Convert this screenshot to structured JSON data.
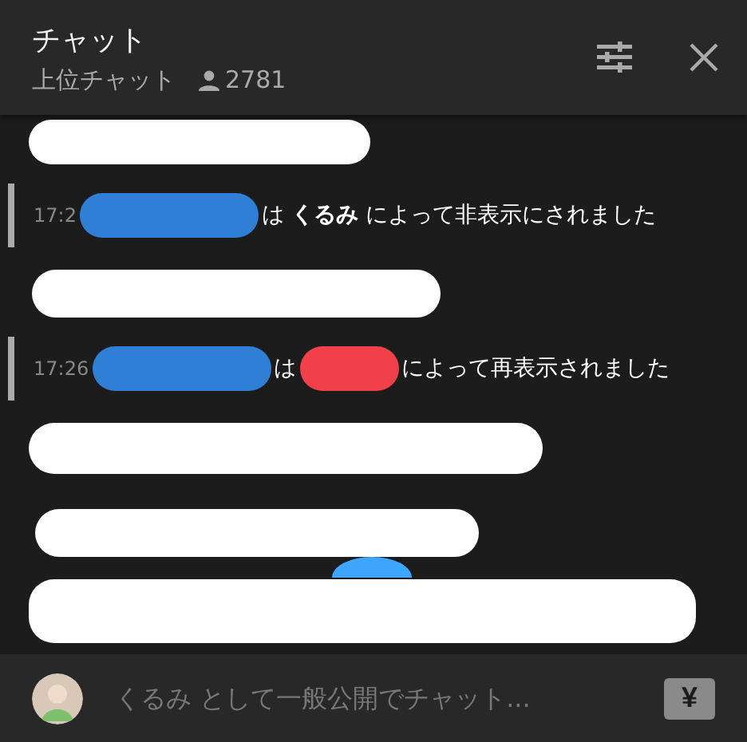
{
  "header": {
    "title": "チャット",
    "subtitle": "上位チャット",
    "viewer_count": "2781"
  },
  "messages": [
    {
      "kind": "redacted",
      "color": "#ffffff"
    },
    {
      "kind": "moderation",
      "segments": [
        {
          "kind": "time",
          "text": "17:2"
        },
        {
          "kind": "mark",
          "color": "#2f7fd6"
        },
        {
          "kind": "text",
          "text": "は **くるみ** によって非表示にされました"
        }
      ]
    },
    {
      "kind": "redacted",
      "color": "#ffffff"
    },
    {
      "kind": "moderation",
      "segments": [
        {
          "kind": "time",
          "text": "17:26"
        },
        {
          "kind": "mark",
          "color": "#2f7fd6"
        },
        {
          "kind": "text",
          "text": "は"
        },
        {
          "kind": "mark",
          "color": "#f2404a"
        },
        {
          "kind": "text",
          "text": "によって再表示されました"
        }
      ]
    },
    {
      "kind": "redacted",
      "color": "#ffffff"
    },
    {
      "kind": "redacted",
      "color": "#ffffff"
    },
    {
      "kind": "redacted",
      "color": "#ffffff"
    }
  ],
  "input": {
    "placeholder": "くるみ として一般公開でチャット..."
  },
  "super_chat": {
    "label": "¥"
  }
}
